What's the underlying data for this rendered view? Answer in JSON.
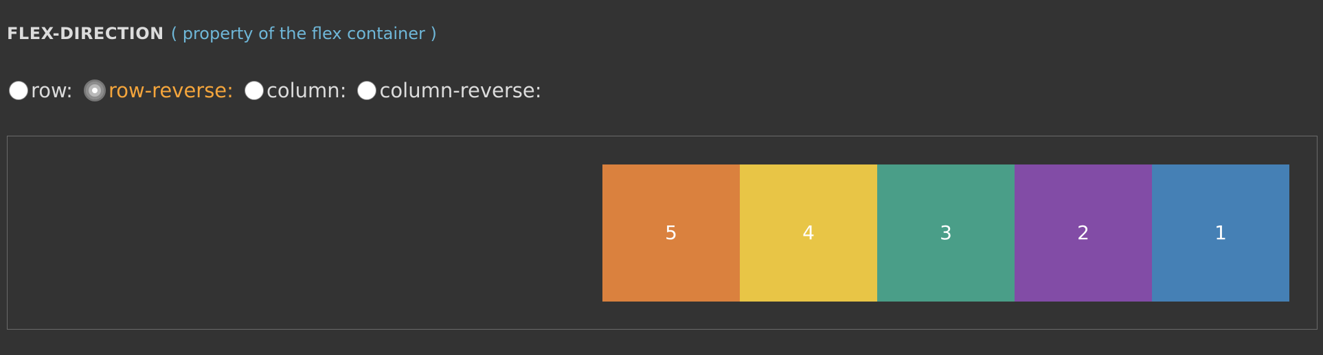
{
  "heading": {
    "property": "FLEX-DIRECTION",
    "description": "( property of the flex container )"
  },
  "options": [
    {
      "label": "row:",
      "checked": false
    },
    {
      "label": "row-reverse:",
      "checked": true
    },
    {
      "label": "column:",
      "checked": false
    },
    {
      "label": "column-reverse:",
      "checked": false
    }
  ],
  "colors": {
    "background": "#333333",
    "active_option": "#f4a53c",
    "description": "#6fb7d8"
  },
  "flex_items": [
    {
      "label": "1",
      "color": "#4580b5"
    },
    {
      "label": "2",
      "color": "#824ca6"
    },
    {
      "label": "3",
      "color": "#4a9e88"
    },
    {
      "label": "4",
      "color": "#e8c546"
    },
    {
      "label": "5",
      "color": "#da813e"
    }
  ]
}
